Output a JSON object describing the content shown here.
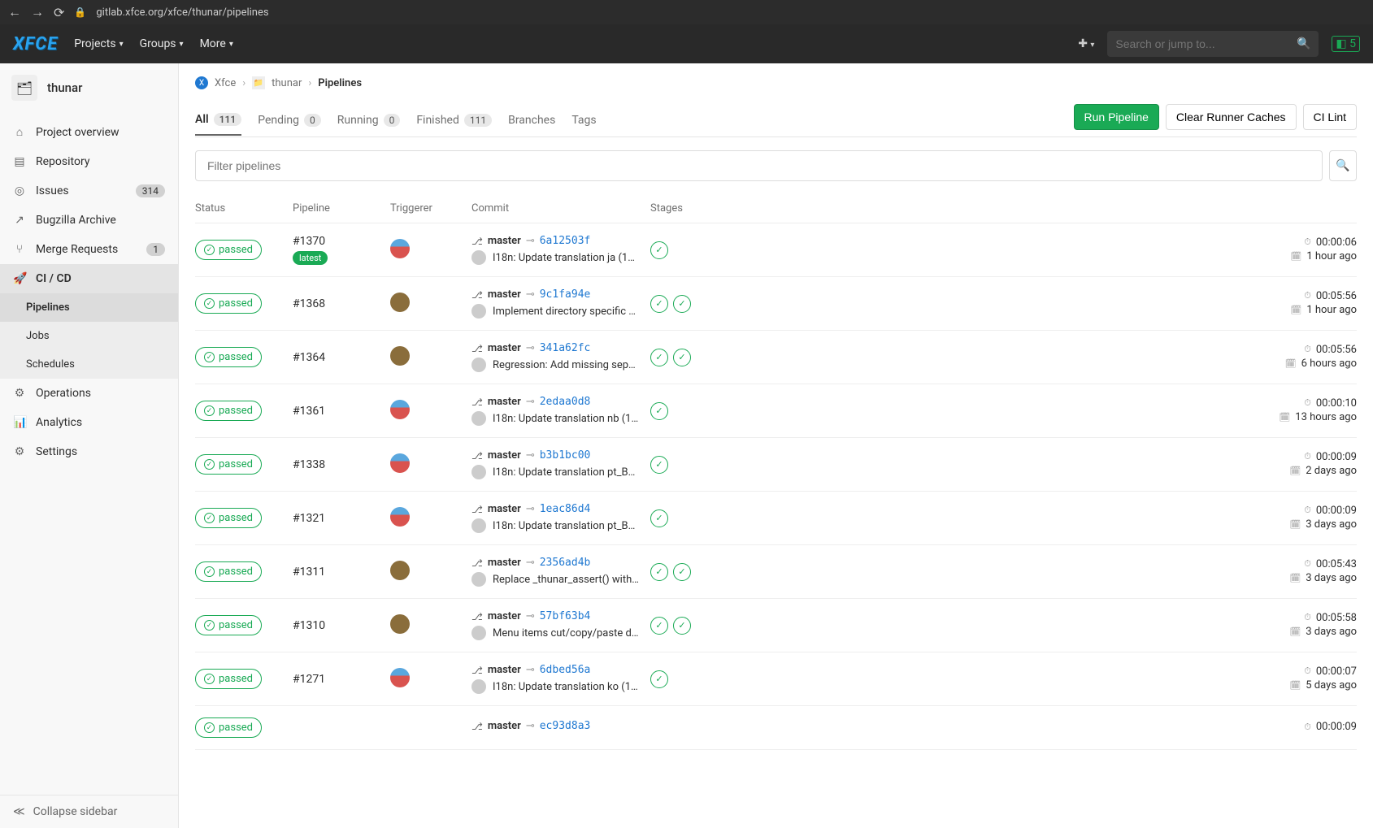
{
  "browser": {
    "url": "gitlab.xfce.org/xfce/thunar/pipelines"
  },
  "topbar": {
    "logo": "XFCE",
    "menu": [
      "Projects",
      "Groups",
      "More"
    ],
    "search_placeholder": "Search or jump to...",
    "todo_count": "5"
  },
  "sidebar": {
    "project_name": "thunar",
    "items": [
      {
        "icon": "home",
        "label": "Project overview"
      },
      {
        "icon": "repo",
        "label": "Repository"
      },
      {
        "icon": "issues",
        "label": "Issues",
        "badge": "314"
      },
      {
        "icon": "ext",
        "label": "Bugzilla Archive"
      },
      {
        "icon": "merge",
        "label": "Merge Requests",
        "badge": "1"
      },
      {
        "icon": "cicd",
        "label": "CI / CD",
        "active": true
      },
      {
        "icon": "ops",
        "label": "Operations"
      },
      {
        "icon": "analytics",
        "label": "Analytics"
      },
      {
        "icon": "settings",
        "label": "Settings"
      }
    ],
    "sub_items": [
      "Pipelines",
      "Jobs",
      "Schedules"
    ],
    "collapse_label": "Collapse sidebar"
  },
  "breadcrumb": {
    "root": "Xfce",
    "project": "thunar",
    "page": "Pipelines"
  },
  "tabs": [
    {
      "label": "All",
      "count": "111",
      "active": true
    },
    {
      "label": "Pending",
      "count": "0"
    },
    {
      "label": "Running",
      "count": "0"
    },
    {
      "label": "Finished",
      "count": "111"
    },
    {
      "label": "Branches"
    },
    {
      "label": "Tags"
    }
  ],
  "actions": {
    "run": "Run Pipeline",
    "clear": "Clear Runner Caches",
    "lint": "CI Lint"
  },
  "filter_placeholder": "Filter pipelines",
  "columns": {
    "status": "Status",
    "pipeline": "Pipeline",
    "triggerer": "Triggerer",
    "commit": "Commit",
    "stages": "Stages"
  },
  "pipelines": [
    {
      "status": "passed",
      "id": "#1370",
      "latest": true,
      "avatar": "bot",
      "branch": "master",
      "sha": "6a12503f",
      "msg": "I18n: Update translation ja (10...",
      "stages": 1,
      "duration": "00:00:06",
      "ago": "1 hour ago"
    },
    {
      "status": "passed",
      "id": "#1368",
      "avatar": "u1",
      "branch": "master",
      "sha": "9c1fa94e",
      "msg": "Implement directory specific s...",
      "stages": 2,
      "duration": "00:05:56",
      "ago": "1 hour ago"
    },
    {
      "status": "passed",
      "id": "#1364",
      "avatar": "u2",
      "branch": "master",
      "sha": "341a62fc",
      "msg": "Regression: Add missing sepe...",
      "stages": 2,
      "duration": "00:05:56",
      "ago": "6 hours ago"
    },
    {
      "status": "passed",
      "id": "#1361",
      "avatar": "bot",
      "branch": "master",
      "sha": "2edaa0d8",
      "msg": "I18n: Update translation nb (1...",
      "stages": 1,
      "duration": "00:00:10",
      "ago": "13 hours ago"
    },
    {
      "status": "passed",
      "id": "#1338",
      "avatar": "bot",
      "branch": "master",
      "sha": "b3b1bc00",
      "msg": "I18n: Update translation pt_BR...",
      "stages": 1,
      "duration": "00:00:09",
      "ago": "2 days ago"
    },
    {
      "status": "passed",
      "id": "#1321",
      "avatar": "bot",
      "branch": "master",
      "sha": "1eac86d4",
      "msg": "I18n: Update translation pt_BR...",
      "stages": 1,
      "duration": "00:00:09",
      "ago": "3 days ago"
    },
    {
      "status": "passed",
      "id": "#1311",
      "avatar": "u1",
      "branch": "master",
      "sha": "2356ad4b",
      "msg": "Replace _thunar_assert() with ...",
      "stages": 2,
      "duration": "00:05:43",
      "ago": "3 days ago"
    },
    {
      "status": "passed",
      "id": "#1310",
      "avatar": "u2",
      "branch": "master",
      "sha": "57bf63b4",
      "msg": "Menu items cut/copy/paste do...",
      "stages": 2,
      "duration": "00:05:58",
      "ago": "3 days ago"
    },
    {
      "status": "passed",
      "id": "#1271",
      "avatar": "bot",
      "branch": "master",
      "sha": "6dbed56a",
      "msg": "I18n: Update translation ko (1...",
      "stages": 1,
      "duration": "00:00:07",
      "ago": "5 days ago"
    },
    {
      "status": "passed",
      "id": "",
      "avatar": "",
      "branch": "master",
      "sha": "ec93d8a3",
      "msg": "",
      "stages": 0,
      "duration": "00:00:09",
      "ago": ""
    }
  ]
}
